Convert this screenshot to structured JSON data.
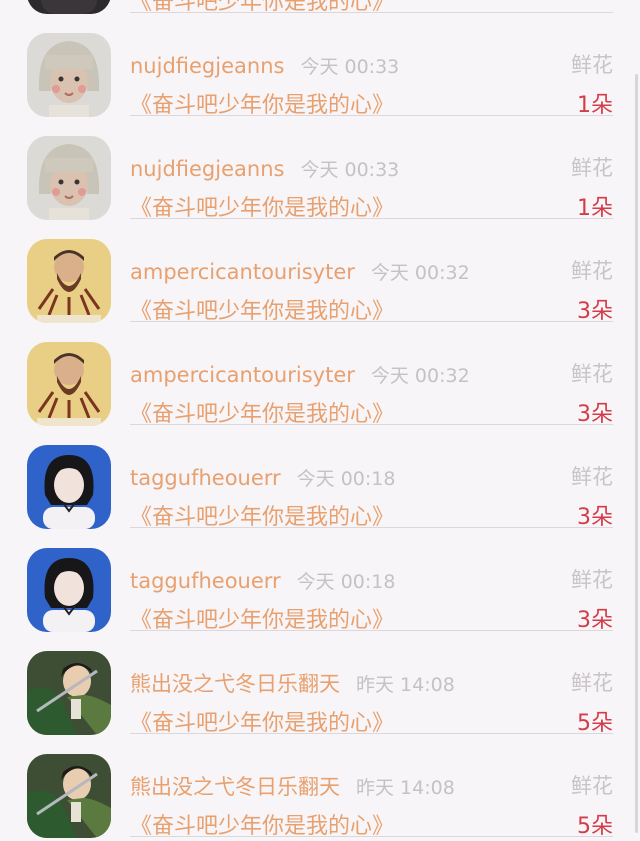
{
  "gift_label": "鲜花",
  "message": "《奋斗吧少年你是我的心》",
  "rows": [
    {
      "name": "",
      "time": "",
      "count": "",
      "avatar": "dark-portrait"
    },
    {
      "name": "nujdfiegjeanns",
      "time": "今天 00:33",
      "count": "1朵",
      "avatar": "blonde-child"
    },
    {
      "name": "nujdfiegjeanns",
      "time": "今天 00:33",
      "count": "1朵",
      "avatar": "blonde-child"
    },
    {
      "name": "ampercicantourisyter",
      "time": "今天 00:32",
      "count": "3朵",
      "avatar": "beard-man"
    },
    {
      "name": "ampercicantourisyter",
      "time": "今天 00:32",
      "count": "3朵",
      "avatar": "beard-man"
    },
    {
      "name": "taggufheouerr",
      "time": "今天 00:18",
      "count": "3朵",
      "avatar": "dark-hair-girl"
    },
    {
      "name": "taggufheouerr",
      "time": "今天 00:18",
      "count": "3朵",
      "avatar": "dark-hair-girl"
    },
    {
      "name": "熊出没之弋冬日乐翻天",
      "time": "昨天 14:08",
      "count": "5朵",
      "avatar": "anime-soldier"
    },
    {
      "name": "熊出没之弋冬日乐翻天",
      "time": "昨天 14:08",
      "count": "5朵",
      "avatar": "anime-soldier"
    }
  ]
}
